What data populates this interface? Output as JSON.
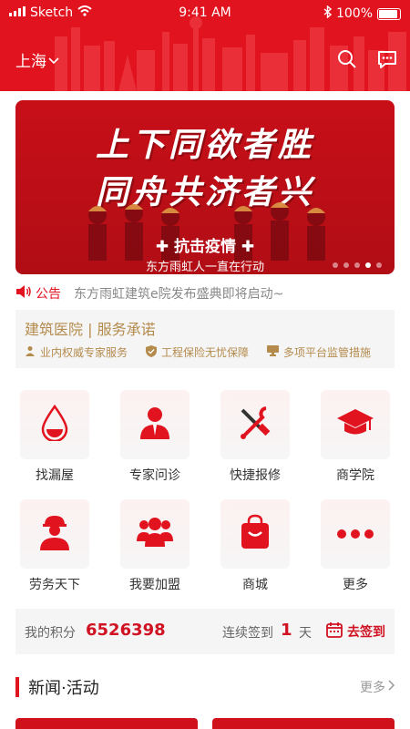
{
  "status_bar": {
    "carrier": "Sketch",
    "time": "9:41 AM",
    "battery": "100%"
  },
  "header": {
    "city": "上海"
  },
  "banner": {
    "title_line1": "上下同欲者胜",
    "title_line2": "同舟共济者兴",
    "tag": "抗击疫情",
    "subtitle": "东方雨虹人一直在行动",
    "slide_count": 5,
    "active_slide": 4
  },
  "notice": {
    "label": "公告",
    "text": "东方雨虹建筑e院发布盛典即将启动~"
  },
  "hospital": {
    "title": "建筑医院 | 服务承诺",
    "features": [
      "业内权威专家服务",
      "工程保险无忧保障",
      "多项平台监管措施"
    ]
  },
  "grid": [
    {
      "label": "找漏屋",
      "icon": "water-drop-icon"
    },
    {
      "label": "专家问诊",
      "icon": "expert-icon"
    },
    {
      "label": "快捷报修",
      "icon": "tools-icon"
    },
    {
      "label": "商学院",
      "icon": "graduation-cap-icon"
    },
    {
      "label": "劳务天下",
      "icon": "worker-icon"
    },
    {
      "label": "我要加盟",
      "icon": "group-icon"
    },
    {
      "label": "商城",
      "icon": "shopping-bag-icon"
    },
    {
      "label": "更多",
      "icon": "more-icon"
    }
  ],
  "points": {
    "label": "我的积分",
    "value": "6526398",
    "streak_label": "连续签到",
    "streak_days": "1",
    "streak_unit": "天",
    "checkin_label": "去签到"
  },
  "news": {
    "title": "新闻·活动",
    "more": "更多"
  },
  "colors": {
    "brand_red": "#e1131f",
    "gold": "#b48b4d"
  }
}
